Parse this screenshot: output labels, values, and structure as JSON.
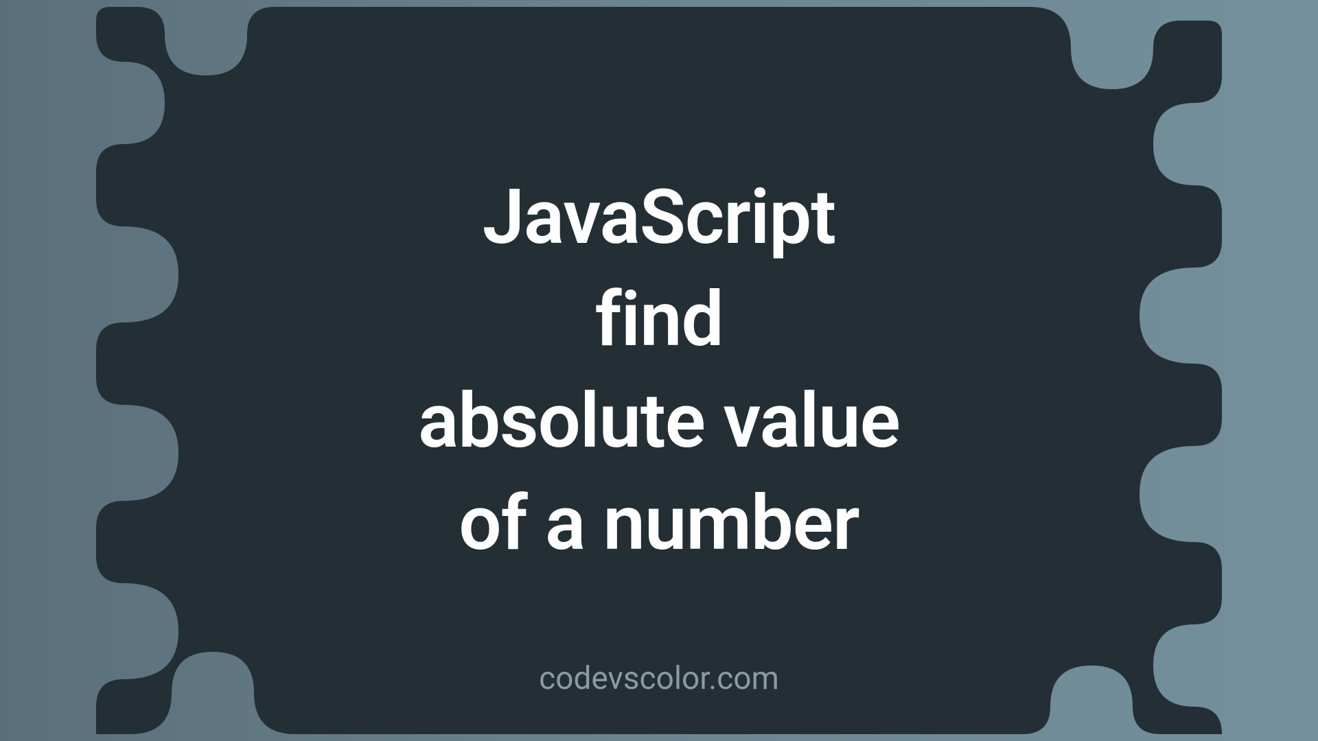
{
  "title": {
    "line1": "JavaScript",
    "line2": "find",
    "line3": "absolute value",
    "line4": "of a number"
  },
  "attribution": "codevscolor.com"
}
